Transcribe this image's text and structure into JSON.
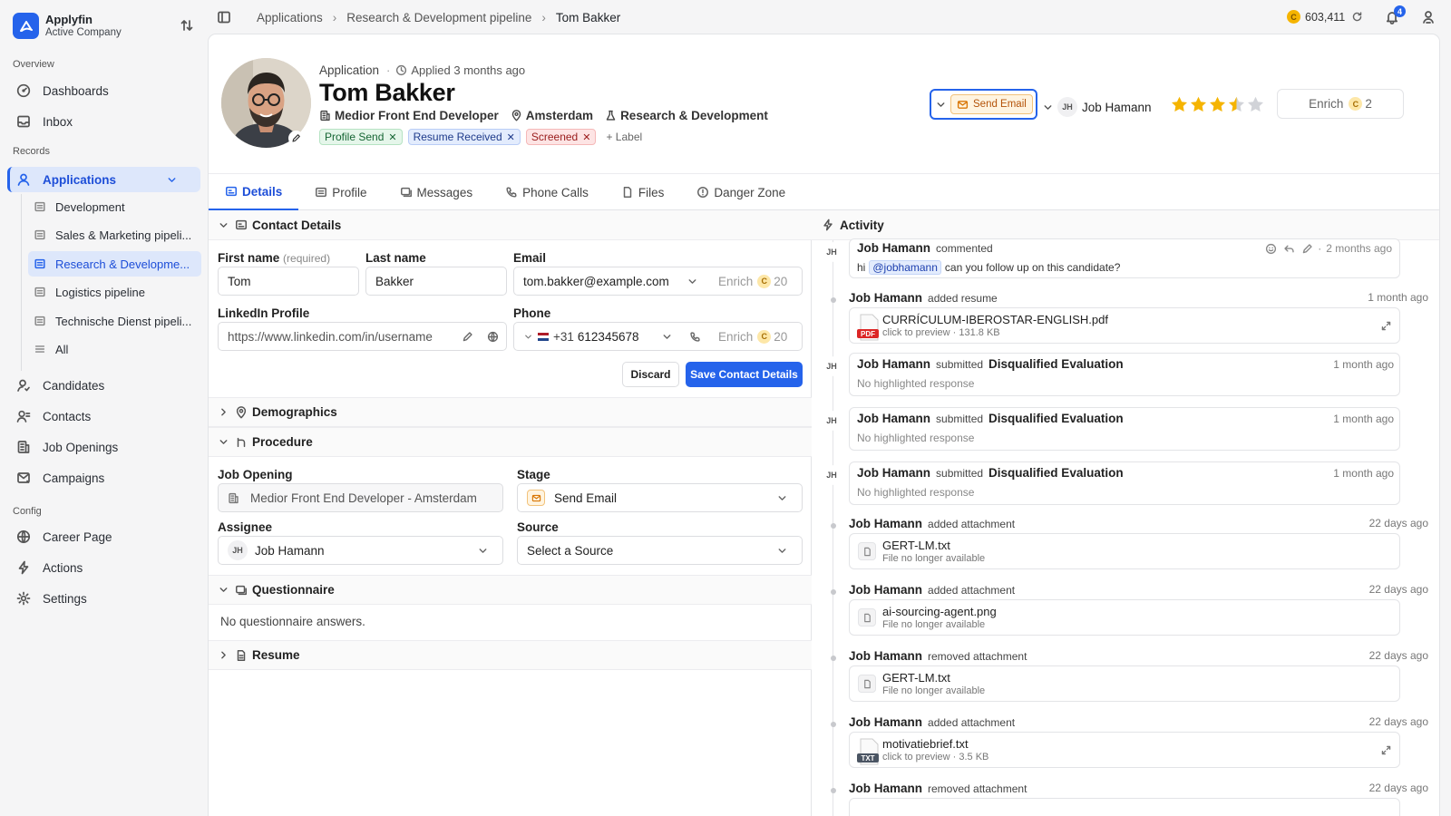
{
  "brand": {
    "name": "Applyfin",
    "company": "Active Company"
  },
  "sidebar": {
    "sections": {
      "overview": "Overview",
      "records": "Records",
      "config": "Config"
    },
    "overview": [
      {
        "label": "Dashboards",
        "icon": "dashboard-icon"
      },
      {
        "label": "Inbox",
        "icon": "inbox-icon"
      }
    ],
    "applications": {
      "label": "Applications",
      "icon": "user-icon"
    },
    "pipelines": [
      {
        "label": "Development"
      },
      {
        "label": "Sales & Marketing pipeli..."
      },
      {
        "label": "Research & Developme..."
      },
      {
        "label": "Logistics pipeline"
      },
      {
        "label": "Technische Dienst pipeli..."
      },
      {
        "label": "All"
      }
    ],
    "records": [
      {
        "label": "Candidates",
        "icon": "candidate-icon"
      },
      {
        "label": "Contacts",
        "icon": "contacts-icon"
      },
      {
        "label": "Job Openings",
        "icon": "building-icon"
      },
      {
        "label": "Campaigns",
        "icon": "mail-icon"
      }
    ],
    "config": [
      {
        "label": "Career Page",
        "icon": "globe-icon"
      },
      {
        "label": "Actions",
        "icon": "bolt-icon"
      },
      {
        "label": "Settings",
        "icon": "gear-icon"
      }
    ]
  },
  "topbar": {
    "breadcrumbs": [
      "Applications",
      "Research & Development pipeline",
      "Tom Bakker"
    ],
    "credits": "603,411",
    "notifications": "4"
  },
  "header": {
    "kind": "Application",
    "applied": "Applied 3 months ago",
    "name": "Tom Bakker",
    "role": "Medior Front End Developer",
    "location": "Amsterdam",
    "department": "Research & Development",
    "tags": [
      "Profile Send",
      "Resume Received",
      "Screened"
    ],
    "add_label": "+ Label",
    "stage_button": "Send Email",
    "assignee": {
      "initials": "JH",
      "name": "Job Hamann"
    },
    "rating": 3.5,
    "rating_max": 5,
    "enrich": {
      "label": "Enrich",
      "cost": "2"
    }
  },
  "tabs": [
    "Details",
    "Profile",
    "Messages",
    "Phone Calls",
    "Files",
    "Danger Zone"
  ],
  "contact": {
    "title": "Contact Details",
    "first_name_label": "First name",
    "required": "(required)",
    "first_name": "Tom",
    "last_name_label": "Last name",
    "last_name": "Bakker",
    "email_label": "Email",
    "email": "tom.bakker@example.com",
    "enrich_label": "Enrich",
    "enrich_cost": "20",
    "linkedin_label": "LinkedIn Profile",
    "linkedin_placeholder": "https://www.linkedin.com/in/username",
    "phone_label": "Phone",
    "phone_code": "+31",
    "phone": "612345678",
    "discard": "Discard",
    "save": "Save Contact Details"
  },
  "demographics": {
    "title": "Demographics"
  },
  "procedure": {
    "title": "Procedure",
    "job_opening_label": "Job Opening",
    "job_opening": "Medior Front End Developer - Amsterdam",
    "stage_label": "Stage",
    "stage": "Send Email",
    "assignee_label": "Assignee",
    "assignee_initials": "JH",
    "assignee": "Job Hamann",
    "source_label": "Source",
    "source": "Select a Source"
  },
  "questionnaire": {
    "title": "Questionnaire",
    "empty": "No questionnaire answers."
  },
  "resume": {
    "title": "Resume"
  },
  "activity": {
    "title": "Activity",
    "events": [
      {
        "who": "Job Hamann",
        "action": "commented",
        "time": "2 months ago",
        "text_pre": "hi",
        "mention": "@jobhamann",
        "text_post": "can you follow up on this candidate?"
      },
      {
        "who": "Job Hamann",
        "action": "added resume",
        "time": "1 month ago",
        "file": "CURRÍCULUM-IBEROSTAR-ENGLISH.pdf",
        "file_type": "PDF",
        "sub": "click to preview",
        "size": "131.8 KB"
      },
      {
        "who": "Job Hamann",
        "action": "submitted",
        "target": "Disqualified Evaluation",
        "time": "1 month ago",
        "sub": "No highlighted response"
      },
      {
        "who": "Job Hamann",
        "action": "submitted",
        "target": "Disqualified Evaluation",
        "time": "1 month ago",
        "sub": "No highlighted response"
      },
      {
        "who": "Job Hamann",
        "action": "submitted",
        "target": "Disqualified Evaluation",
        "time": "1 month ago",
        "sub": "No highlighted response"
      },
      {
        "who": "Job Hamann",
        "action": "added attachment",
        "time": "22 days ago",
        "file": "GERT-LM.txt",
        "sub": "File no longer available"
      },
      {
        "who": "Job Hamann",
        "action": "added attachment",
        "time": "22 days ago",
        "file": "ai-sourcing-agent.png",
        "sub": "File no longer available"
      },
      {
        "who": "Job Hamann",
        "action": "removed attachment",
        "time": "22 days ago",
        "file": "GERT-LM.txt",
        "sub": "File no longer available"
      },
      {
        "who": "Job Hamann",
        "action": "added attachment",
        "time": "22 days ago",
        "file": "motivatiebrief.txt",
        "file_type": "TXT",
        "sub": "click to preview",
        "size": "3.5 KB"
      },
      {
        "who": "Job Hamann",
        "action": "removed attachment",
        "time": "22 days ago"
      }
    ]
  },
  "colors": {
    "accent": "#2563eb",
    "star": "#f5b400",
    "coin": "#f5b400"
  }
}
